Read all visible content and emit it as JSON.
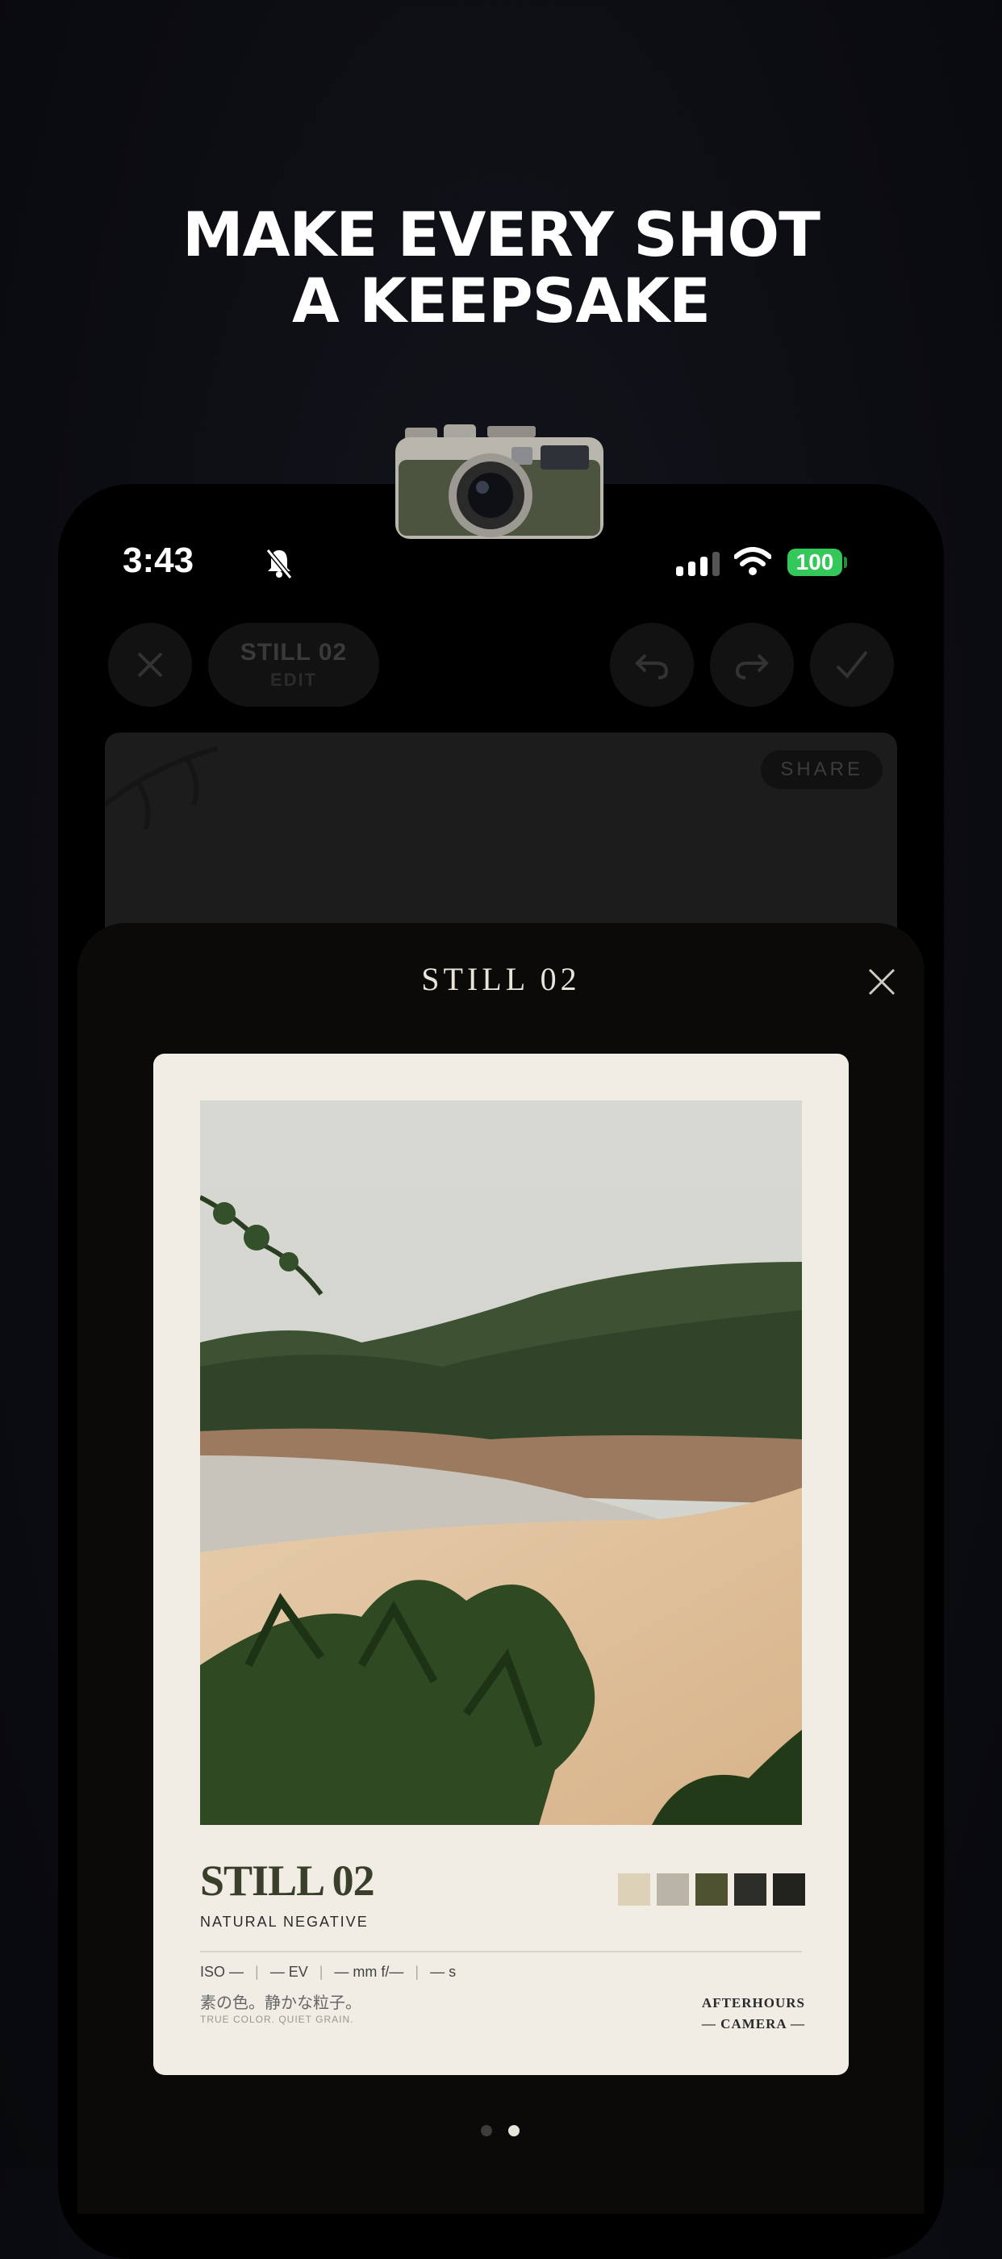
{
  "headline": {
    "line1": "MAKE EVERY SHOT",
    "line2": "A KEEPSAKE"
  },
  "status_bar": {
    "time": "3:43",
    "battery": "100"
  },
  "editor": {
    "pill_title": "STILL 02",
    "pill_subtitle": "EDIT",
    "share_label": "SHARE"
  },
  "sheet": {
    "title": "STILL 02"
  },
  "card": {
    "title": "STILL 02",
    "subtitle": "NATURAL NEGATIVE",
    "swatches": [
      "#ddd1b8",
      "#b9b4a6",
      "#4f5230",
      "#2c2e27",
      "#22231e"
    ],
    "exif": {
      "iso": "ISO —",
      "ev": "— EV",
      "lens": "— mm f/—",
      "shutter": "— s"
    },
    "japanese_line": "素の色。静かな粒子。",
    "motto": "TRUE COLOR. QUIET GRAIN.",
    "brand_line1": "AFTERHOURS",
    "brand_line2": "— CAMERA —"
  },
  "pager": {
    "count": 2,
    "active": 2
  },
  "colors": {
    "battery": "#34c759",
    "card_bg": "#f1ede5",
    "title_ink": "#3a3f2c"
  }
}
